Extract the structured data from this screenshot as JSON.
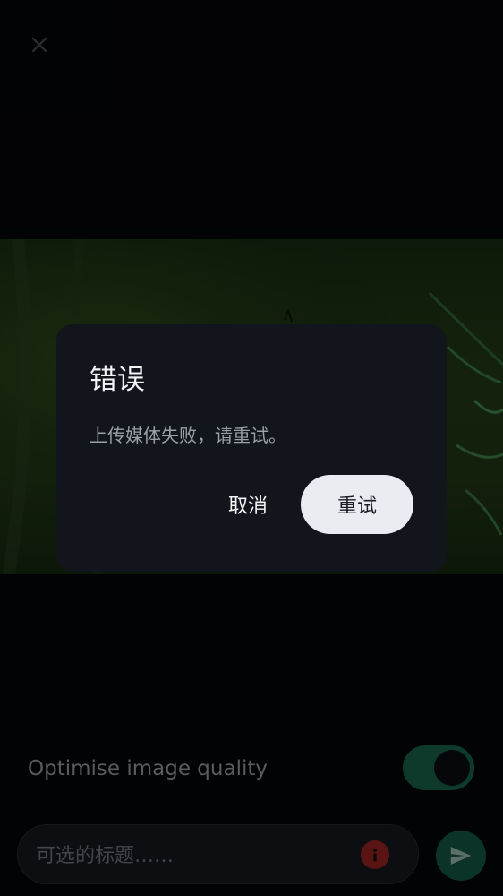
{
  "toolbar": {
    "close_icon": "close-icon"
  },
  "dialog": {
    "title": "错误",
    "message": "上传媒体失败，请重试。",
    "cancel_label": "取消",
    "retry_label": "重试"
  },
  "settings": {
    "optimise_label": "Optimise image quality",
    "optimise_enabled": true
  },
  "composer": {
    "caption_placeholder": "可选的标题……",
    "info_icon": "info-icon",
    "send_icon": "send-icon"
  },
  "colors": {
    "accent": "#0e3a2c",
    "error": "#5a1414",
    "dialog_bg": "#12151b",
    "retry_button_bg": "#e9ecf1"
  }
}
